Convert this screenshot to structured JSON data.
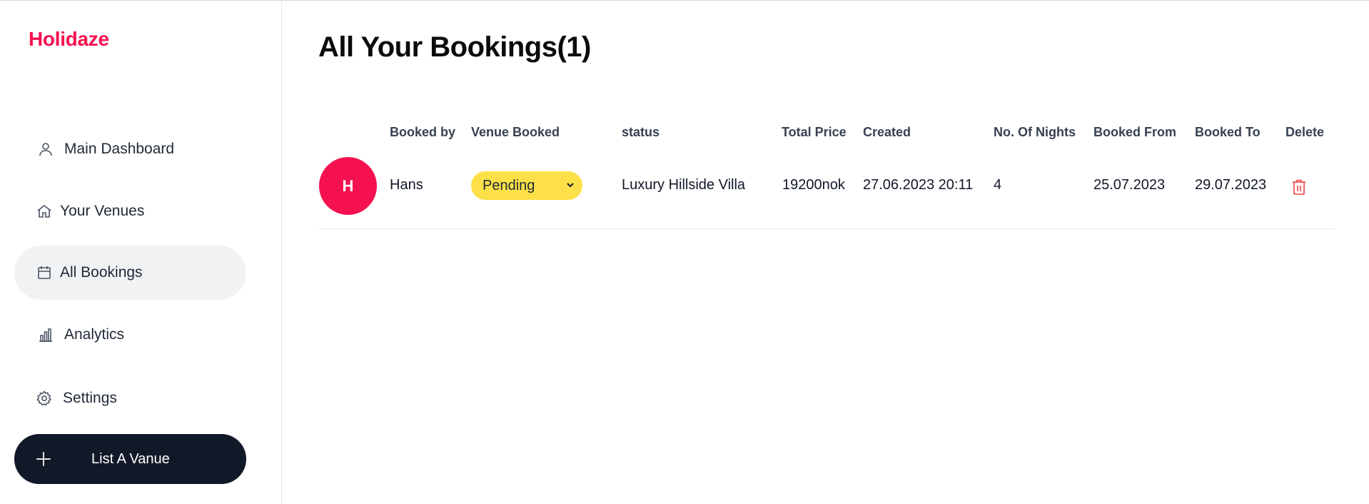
{
  "brand": {
    "name": "Holidaze",
    "color": "#f5114f"
  },
  "sidebar": {
    "items": [
      {
        "label": "Main Dashboard",
        "icon": "user-icon",
        "active": false
      },
      {
        "label": "Your Venues",
        "icon": "home-icon",
        "active": false
      },
      {
        "label": "All Bookings",
        "icon": "calendar-icon",
        "active": true
      },
      {
        "label": "Analytics",
        "icon": "bar-chart-icon",
        "active": false
      },
      {
        "label": "Settings",
        "icon": "gear-icon",
        "active": false
      }
    ],
    "cta": {
      "label": "List A Vanue",
      "icon": "plus-icon"
    }
  },
  "main": {
    "title": "All Your Bookings(1)",
    "table": {
      "headers": [
        "Booked by",
        "Venue Booked",
        "status",
        "Total Price",
        "Created",
        "No. Of Nights",
        "Booked From",
        "Booked To",
        "Delete"
      ],
      "rows": [
        {
          "avatar_initial": "H",
          "booked_by": "Hans",
          "status": "Pending",
          "venue": "Luxury Hillside Villa",
          "total_price": "19200nok",
          "created": "27.06.2023 20:11",
          "nights": "4",
          "booked_from": "25.07.2023",
          "booked_to": "29.07.2023",
          "delete_icon": "trash-icon"
        }
      ]
    }
  },
  "colors": {
    "accent": "#f5114f",
    "status_pending": "#fde047",
    "dark": "#111827",
    "delete": "#ef4444"
  }
}
